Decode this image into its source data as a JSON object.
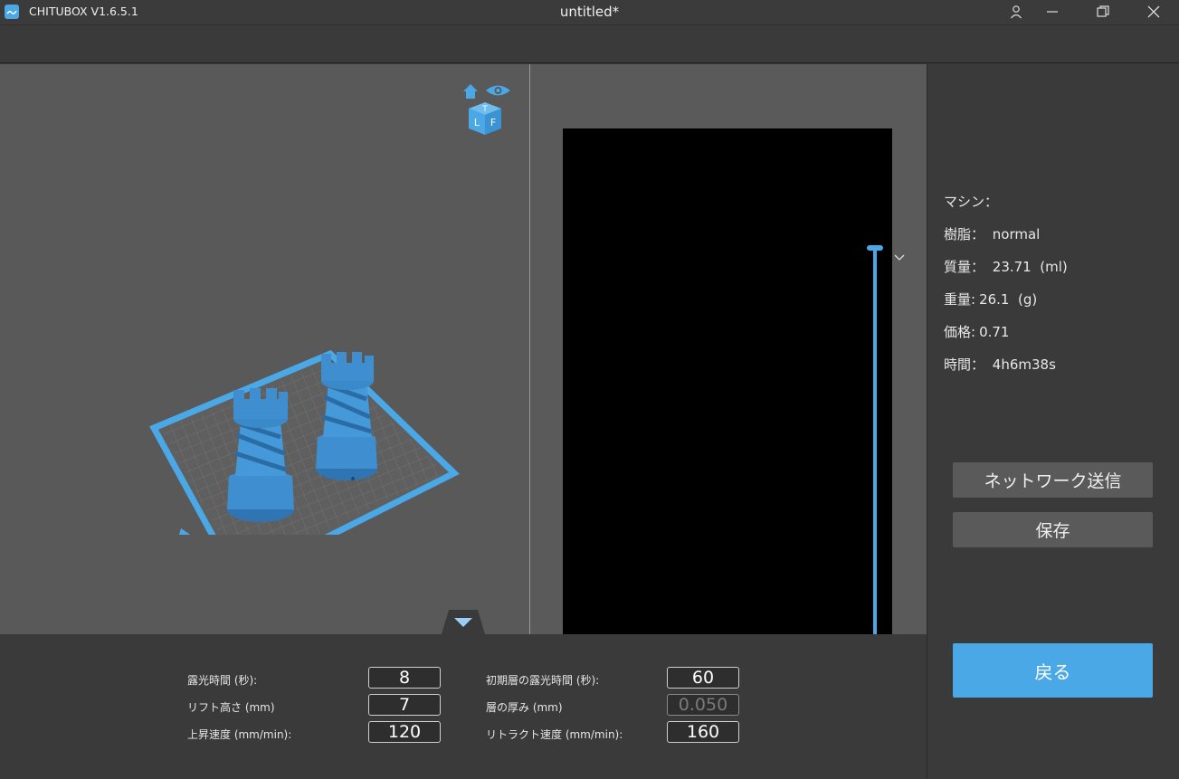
{
  "titlebar": {
    "app_name": "CHITUBOX V1.6.5.1",
    "document_title": "untitled*"
  },
  "view_cube": {
    "faces": [
      "T",
      "L",
      "F"
    ]
  },
  "info": {
    "machine_label": "マシン：",
    "machine_value": "",
    "resin_label": "樹脂：",
    "resin_value": " normal",
    "volume_label": "質量：",
    "volume_value": " 23.71  (ml)",
    "weight_label": "重量:",
    "weight_value": "26.1  (g)",
    "price_label": "価格:",
    "price_value": "0.71",
    "time_label": "時間：",
    "time_value": " 4h6m38s"
  },
  "buttons": {
    "network_send": "ネットワーク送信",
    "save": "保存",
    "back": "戻る"
  },
  "params": {
    "exposure_time_label": "露光時間 (秒):",
    "exposure_time_value": "8",
    "lift_height_label": "リフト高さ (mm)",
    "lift_height_value": "7",
    "lift_speed_label": "上昇速度 (mm/min):",
    "lift_speed_value": "120",
    "bottom_exposure_label": "初期層の露光時間 (秒):",
    "bottom_exposure_value": "60",
    "layer_height_label": "層の厚み (mm)",
    "layer_height_value": "0.050",
    "retract_speed_label": "リトラクト速度 (mm/min):",
    "retract_speed_value": "160"
  },
  "layer_slider": {
    "level": 1.0
  },
  "colors": {
    "accent": "#4aa8e6",
    "panel": "#3a3a3a",
    "viewport": "#595959"
  }
}
